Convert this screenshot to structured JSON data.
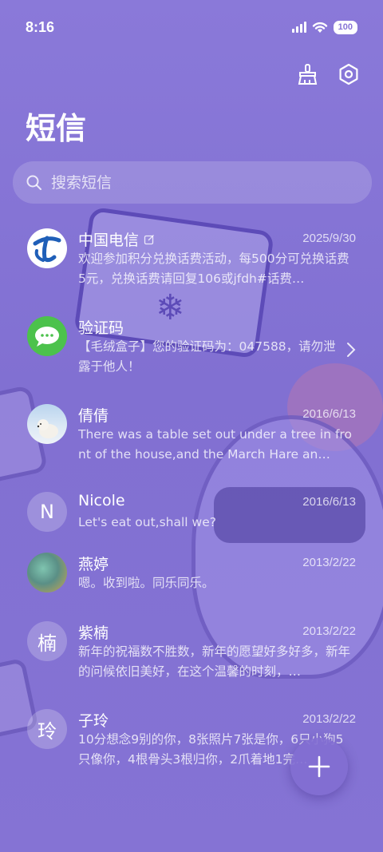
{
  "status": {
    "time": "8:16",
    "battery": "100"
  },
  "header": {
    "title": "短信"
  },
  "search": {
    "placeholder": "搜索短信"
  },
  "conversations": [
    {
      "name": "中国电信",
      "date": "2025/9/30",
      "preview": "欢迎参加积分兑换话费活动，每500分可兑换话费5元，兑换话费请回复106或jfdh#话费…",
      "avatar": "telecom-logo-icon"
    },
    {
      "name": "验证码",
      "date": "",
      "preview": "【毛绒盒子】您的验证码为：047588，请勿泄露于他人！",
      "avatar": "message-bubble-icon"
    },
    {
      "name": "倩倩",
      "date": "2016/6/13",
      "preview": "There was a table set out under a tree in front of the house,and the March Hare an…",
      "avatar": "polar-bear-photo"
    },
    {
      "name": "Nicole",
      "date": "2016/6/13",
      "preview": "Let's eat out,shall we?",
      "avatar_letter": "N"
    },
    {
      "name": "燕婷",
      "date": "2013/2/22",
      "preview": "嗯。收到啦。同乐同乐。",
      "avatar": "landscape-photo"
    },
    {
      "name": "紫楠",
      "date": "2013/2/22",
      "preview": "新年的祝福数不胜数，新年的愿望好多好多，新年的问候依旧美好，在这个温馨的时刻，…",
      "avatar_letter": "楠"
    },
    {
      "name": "子玲",
      "date": "2013/2/22",
      "preview": "10分想念9别的你，8张照片7张是你，6只小狗5只像你，4根骨头3根归你，2爪着地1完…",
      "avatar_letter": "玲"
    }
  ],
  "colors": {
    "background": "#8774d6",
    "telecom_blue": "#1f5fb8",
    "verify_green": "#4cc24c"
  }
}
